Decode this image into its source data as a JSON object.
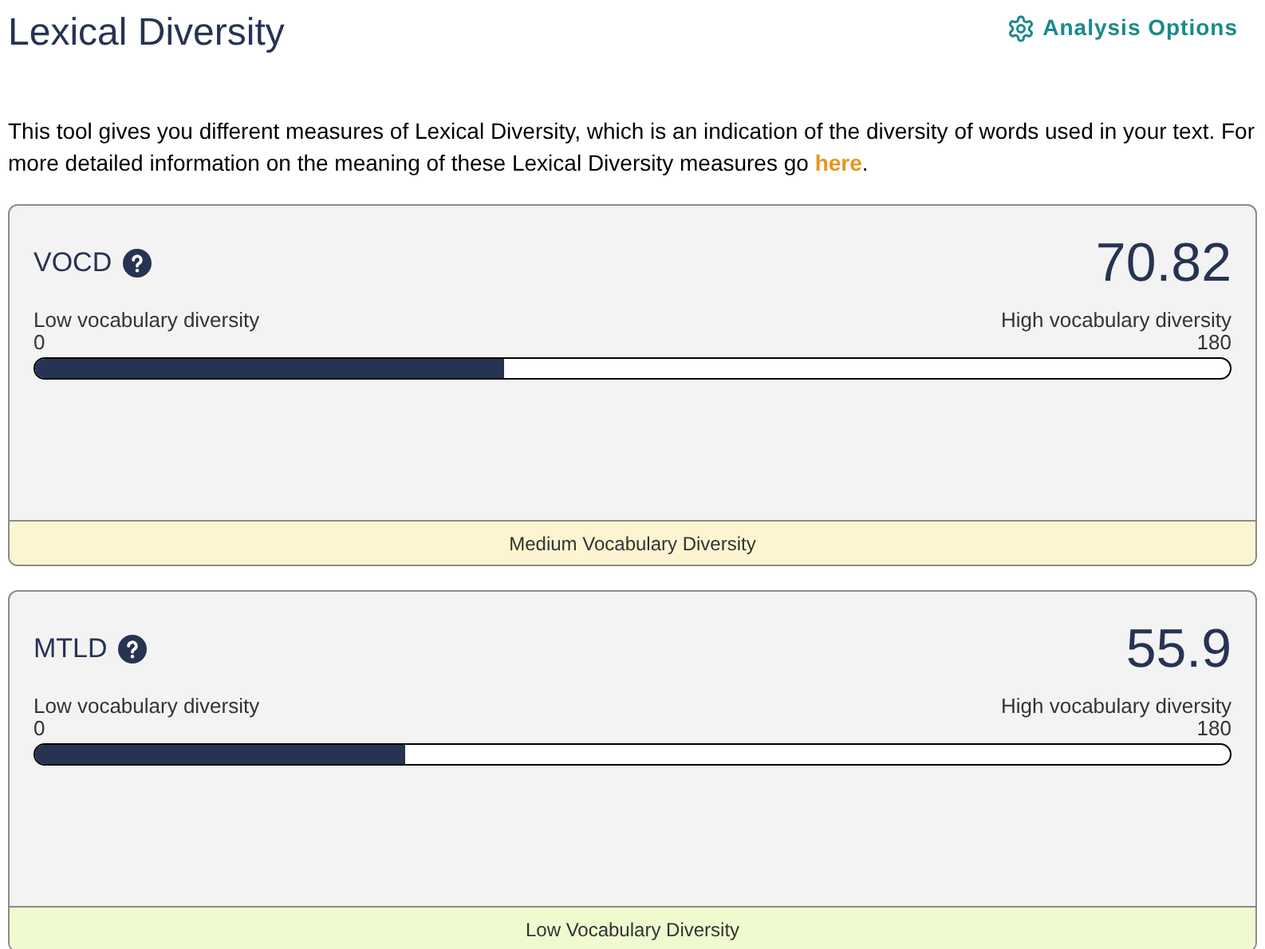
{
  "title": "Lexical Diversity",
  "options_link": "Analysis Options",
  "intro": "This tool gives you different measures of Lexical Diversity, which is an indication of the diversity of words used in your text. For more detailed information on the meaning of these Lexical Diversity measures go ",
  "intro_link": "here",
  "intro_end": ".",
  "measures": [
    {
      "name": "VOCD",
      "value": "70.82",
      "low_label": "Low vocabulary diversity",
      "high_label": "High vocabulary diversity",
      "min": "0",
      "max": "180",
      "level": 0.393,
      "verdict": "Medium Vocabulary Diversity",
      "color": "#fdf5d2"
    },
    {
      "name": "MTLD",
      "value": "55.9",
      "low_label": "Low vocabulary diversity",
      "high_label": "High vocabulary diversity",
      "min": "0",
      "max": "180",
      "level": 0.31,
      "verdict": "Low Vocabulary Diversity",
      "color": "#f0facf"
    }
  ]
}
